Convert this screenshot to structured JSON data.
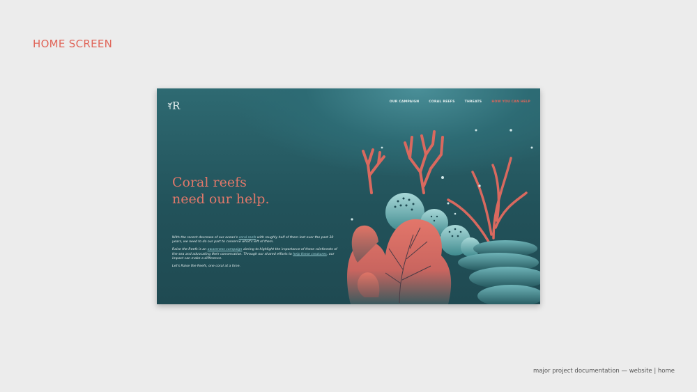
{
  "doc": {
    "heading": "HOME SCREEN",
    "footer": "major project documentation — website | home"
  },
  "site": {
    "logo_letter": "R",
    "nav": [
      {
        "label": "OUR CAMPAIGN"
      },
      {
        "label": "CORAL REEFS"
      },
      {
        "label": "THREATS"
      },
      {
        "label": "HOW YOU CAN HELP"
      }
    ],
    "hero": {
      "title_line1": "Coral reefs",
      "title_line2": "need our help."
    },
    "body": {
      "p1_before": "With the recent decrease of our ocean's ",
      "p1_link": "coral reefs",
      "p1_after": " with roughly half of them lost over the past 30 years, we need to do our part to conserve what's left of them.",
      "p2_before": "Raise the Reefs is an ",
      "p2_link1": "awareness campaign",
      "p2_mid": " aiming to highlight the importance of these rainforests of the sea and advocating their conservation. Through our shared efforts to ",
      "p2_link2": "help these creatures",
      "p2_after": ", our impact can make a difference.",
      "p3": "Let's Raise the Reefs, one coral at a time."
    }
  },
  "colors": {
    "accent": "#e0665a",
    "ocean_dark": "#1f4a52",
    "ocean_light": "#4a8f98"
  }
}
